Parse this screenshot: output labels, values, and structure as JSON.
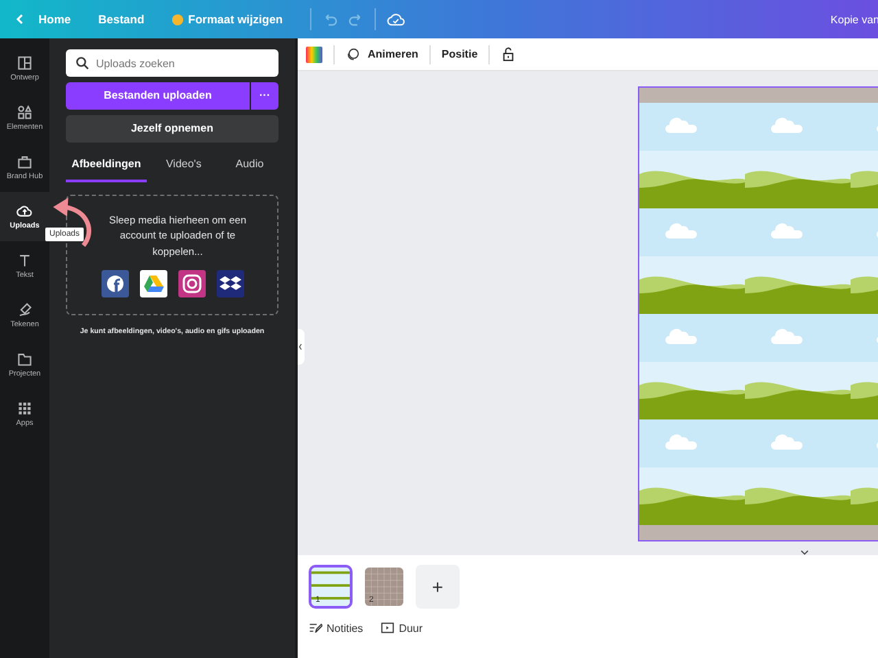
{
  "top_bar": {
    "home": "Home",
    "menu": [
      "Bestand"
    ],
    "resize": "Formaat wijzigen",
    "title": "Kopie van"
  },
  "toolbar": {
    "buttons": [
      "Animeren",
      "Positie"
    ]
  },
  "rail": [
    {
      "label": "Ontwerp",
      "kind": "layout",
      "selected": false
    },
    {
      "label": "Elementen",
      "kind": "shapes",
      "selected": false
    },
    {
      "label": "Brand Hub",
      "kind": "brand",
      "selected": false
    },
    {
      "label": "Uploads",
      "kind": "cloud",
      "selected": true
    },
    {
      "label": "Tekst",
      "kind": "text",
      "selected": false
    },
    {
      "label": "Tekenen",
      "kind": "pen",
      "selected": false
    },
    {
      "label": "Projecten",
      "kind": "folder",
      "selected": false
    },
    {
      "label": "Apps",
      "kind": "apps",
      "selected": false
    }
  ],
  "tooltip": "Uploads",
  "panel": {
    "search": {
      "placeholder": "Uploads zoeken"
    },
    "upload_button": "Bestanden uploaden",
    "more": "···",
    "record_button": "Jezelf opnemen",
    "tabs": [
      {
        "label": "Afbeeldingen",
        "selected": true
      },
      {
        "label": "Video's",
        "selected": false
      },
      {
        "label": "Audio",
        "selected": false
      }
    ],
    "dropzone": "Sleep media hierheen om een account te uploaden of te koppelen...",
    "services": [
      {
        "kind": "f",
        "color": "#3b5998"
      },
      {
        "kind": "drive",
        "color": "#ffffff"
      },
      {
        "kind": "insta",
        "color": "#c13584"
      },
      {
        "kind": "box",
        "color": "#1f2a7a"
      }
    ],
    "note": "Je kunt afbeeldingen, video's, audio en gifs uploaden"
  },
  "pages": [
    {
      "number": "1",
      "kind": "landscape",
      "selected": true
    },
    {
      "number": "2",
      "kind": "grid",
      "selected": false
    }
  ],
  "add_page": "+",
  "footer": [
    "Notities",
    "Duur"
  ]
}
